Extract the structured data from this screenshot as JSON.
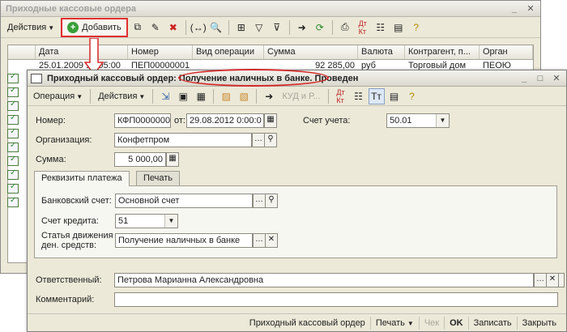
{
  "back_window": {
    "title": "Приходные кассовые ордера",
    "toolbar": {
      "actions_label": "Действия",
      "add_label": "Добавить"
    },
    "columns": [
      "Дата",
      "Номер",
      "Вид операции",
      "Сумма",
      "Валюта",
      "Контрагент, п...",
      "Орган"
    ],
    "first_row": [
      "25.01.2009 13:05:00",
      "ПЕП00000001",
      "",
      "92 285,00",
      "руб",
      "Торговый дом",
      "ПЕОЮ"
    ]
  },
  "front_window": {
    "title_prefix": "Приходный кассовый ордер:",
    "title_operation": "Получение наличных в банке",
    "title_status": ". Проведен",
    "toolbar": {
      "operation_label": "Операция",
      "actions_label": "Действия",
      "kudir_label": "КУД и Р..."
    },
    "form": {
      "number_label": "Номер:",
      "number_value": "КФП0000000",
      "date_label": "от:",
      "date_value": "29.08.2012 0:00:0",
      "account_label": "Счет учета:",
      "account_value": "50.01",
      "org_label": "Организация:",
      "org_value": "Конфетпром",
      "sum_label": "Сумма:",
      "sum_value": "5 000,00"
    },
    "tabs": [
      {
        "label": "Реквизиты платежа"
      },
      {
        "label": "Печать"
      }
    ],
    "payment": {
      "bank_label": "Банковский счет:",
      "bank_value": "Основной счет",
      "credit_label": "Счет кредита:",
      "credit_value": "51",
      "movement_label_1": "Статья движения",
      "movement_label_2": "ден. средств:",
      "movement_value": "Получение наличных в банке"
    },
    "responsible_label": "Ответственный:",
    "responsible_value": "Петрова Марианна Александровна",
    "comment_label": "Комментарий:",
    "comment_value": "",
    "bottom_buttons": {
      "pko": "Приходный кассовый ордер",
      "print": "Печать",
      "check": "Чек",
      "ok": "OK",
      "save": "Записать",
      "close": "Закрыть"
    }
  },
  "colors": {
    "highlight": "#e03030",
    "window_bg": "#ece9d8"
  }
}
